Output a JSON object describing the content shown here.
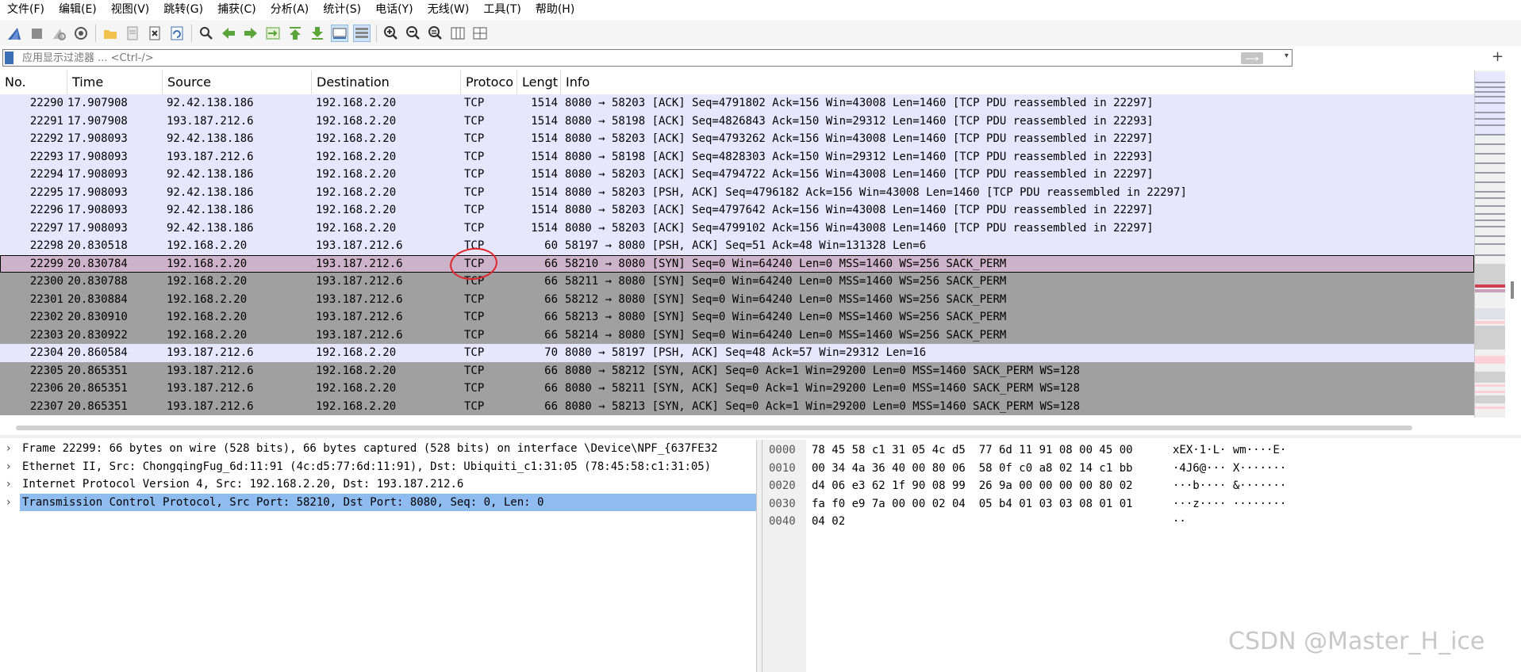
{
  "menubar": {
    "items": [
      "文件(F)",
      "编辑(E)",
      "视图(V)",
      "跳转(G)",
      "捕获(C)",
      "分析(A)",
      "统计(S)",
      "电话(Y)",
      "无线(W)",
      "工具(T)",
      "帮助(H)"
    ]
  },
  "toolbar": {
    "buttons": [
      "shark-fin-start-icon",
      "stop-icon",
      "restart-icon",
      "capture-options-icon",
      "open-folder-icon",
      "save-file-icon",
      "close-file-icon",
      "reload-icon",
      "find-icon",
      "go-back-icon",
      "go-forward-icon",
      "go-to-packet-icon",
      "go-first-icon",
      "go-last-icon",
      "autoscroll-icon",
      "colorize-icon",
      "zoom-in-icon",
      "zoom-out-icon",
      "zoom-normal-icon",
      "resize-columns-icon",
      "layout-icon"
    ]
  },
  "filter": {
    "placeholder": "应用显示过滤器 ... <Ctrl-/>",
    "apply_arrow": "⟶",
    "dropdown": "▾",
    "add": "+"
  },
  "packet_list": {
    "columns": [
      "No.",
      "Time",
      "Source",
      "Destination",
      "Protoco",
      "Lengt",
      "Info"
    ],
    "rows": [
      {
        "no": "22290",
        "time": "17.907908",
        "src": "92.42.138.186",
        "dst": "192.168.2.20",
        "proto": "TCP",
        "len": "1514",
        "info": "8080 → 58203 [ACK] Seq=4791802 Ack=156 Win=43008 Len=1460 [TCP PDU reassembled in 22297]",
        "style": "ack"
      },
      {
        "no": "22291",
        "time": "17.907908",
        "src": "193.187.212.6",
        "dst": "192.168.2.20",
        "proto": "TCP",
        "len": "1514",
        "info": "8080 → 58198 [ACK] Seq=4826843 Ack=150 Win=29312 Len=1460 [TCP PDU reassembled in 22293]",
        "style": "ack"
      },
      {
        "no": "22292",
        "time": "17.908093",
        "src": "92.42.138.186",
        "dst": "192.168.2.20",
        "proto": "TCP",
        "len": "1514",
        "info": "8080 → 58203 [ACK] Seq=4793262 Ack=156 Win=43008 Len=1460 [TCP PDU reassembled in 22297]",
        "style": "ack"
      },
      {
        "no": "22293",
        "time": "17.908093",
        "src": "193.187.212.6",
        "dst": "192.168.2.20",
        "proto": "TCP",
        "len": "1514",
        "info": "8080 → 58198 [ACK] Seq=4828303 Ack=150 Win=29312 Len=1460 [TCP PDU reassembled in 22293]",
        "style": "ack"
      },
      {
        "no": "22294",
        "time": "17.908093",
        "src": "92.42.138.186",
        "dst": "192.168.2.20",
        "proto": "TCP",
        "len": "1514",
        "info": "8080 → 58203 [ACK] Seq=4794722 Ack=156 Win=43008 Len=1460 [TCP PDU reassembled in 22297]",
        "style": "ack"
      },
      {
        "no": "22295",
        "time": "17.908093",
        "src": "92.42.138.186",
        "dst": "192.168.2.20",
        "proto": "TCP",
        "len": "1514",
        "info": "8080 → 58203 [PSH, ACK] Seq=4796182 Ack=156 Win=43008 Len=1460 [TCP PDU reassembled in 22297]",
        "style": "ack"
      },
      {
        "no": "22296",
        "time": "17.908093",
        "src": "92.42.138.186",
        "dst": "192.168.2.20",
        "proto": "TCP",
        "len": "1514",
        "info": "8080 → 58203 [ACK] Seq=4797642 Ack=156 Win=43008 Len=1460 [TCP PDU reassembled in 22297]",
        "style": "ack"
      },
      {
        "no": "22297",
        "time": "17.908093",
        "src": "92.42.138.186",
        "dst": "192.168.2.20",
        "proto": "TCP",
        "len": "1514",
        "info": "8080 → 58203 [ACK] Seq=4799102 Ack=156 Win=43008 Len=1460 [TCP PDU reassembled in 22297]",
        "style": "ack"
      },
      {
        "no": "22298",
        "time": "20.830518",
        "src": "192.168.2.20",
        "dst": "193.187.212.6",
        "proto": "TCP",
        "len": "60",
        "info": "58197 → 8080 [PSH, ACK] Seq=51 Ack=48 Win=131328 Len=6",
        "style": "ack"
      },
      {
        "no": "22299",
        "time": "20.830784",
        "src": "192.168.2.20",
        "dst": "193.187.212.6",
        "proto": "TCP",
        "len": "66",
        "info": "58210 → 8080 [SYN] Seq=0 Win=64240 Len=0 MSS=1460 WS=256 SACK_PERM",
        "style": "sel"
      },
      {
        "no": "22300",
        "time": "20.830788",
        "src": "192.168.2.20",
        "dst": "193.187.212.6",
        "proto": "TCP",
        "len": "66",
        "info": "58211 → 8080 [SYN] Seq=0 Win=64240 Len=0 MSS=1460 WS=256 SACK_PERM",
        "style": "syn"
      },
      {
        "no": "22301",
        "time": "20.830884",
        "src": "192.168.2.20",
        "dst": "193.187.212.6",
        "proto": "TCP",
        "len": "66",
        "info": "58212 → 8080 [SYN] Seq=0 Win=64240 Len=0 MSS=1460 WS=256 SACK_PERM",
        "style": "syn"
      },
      {
        "no": "22302",
        "time": "20.830910",
        "src": "192.168.2.20",
        "dst": "193.187.212.6",
        "proto": "TCP",
        "len": "66",
        "info": "58213 → 8080 [SYN] Seq=0 Win=64240 Len=0 MSS=1460 WS=256 SACK_PERM",
        "style": "syn"
      },
      {
        "no": "22303",
        "time": "20.830922",
        "src": "192.168.2.20",
        "dst": "193.187.212.6",
        "proto": "TCP",
        "len": "66",
        "info": "58214 → 8080 [SYN] Seq=0 Win=64240 Len=0 MSS=1460 WS=256 SACK_PERM",
        "style": "syn"
      },
      {
        "no": "22304",
        "time": "20.860584",
        "src": "193.187.212.6",
        "dst": "192.168.2.20",
        "proto": "TCP",
        "len": "70",
        "info": "8080 → 58197 [PSH, ACK] Seq=48 Ack=57 Win=29312 Len=16",
        "style": "ack"
      },
      {
        "no": "22305",
        "time": "20.865351",
        "src": "193.187.212.6",
        "dst": "192.168.2.20",
        "proto": "TCP",
        "len": "66",
        "info": "8080 → 58212 [SYN, ACK] Seq=0 Ack=1 Win=29200 Len=0 MSS=1460 SACK_PERM WS=128",
        "style": "syn"
      },
      {
        "no": "22306",
        "time": "20.865351",
        "src": "193.187.212.6",
        "dst": "192.168.2.20",
        "proto": "TCP",
        "len": "66",
        "info": "8080 → 58211 [SYN, ACK] Seq=0 Ack=1 Win=29200 Len=0 MSS=1460 SACK_PERM WS=128",
        "style": "syn"
      },
      {
        "no": "22307",
        "time": "20.865351",
        "src": "193.187.212.6",
        "dst": "192.168.2.20",
        "proto": "TCP",
        "len": "66",
        "info": "8080 → 58213 [SYN, ACK] Seq=0 Ack=1 Win=29200 Len=0 MSS=1460 SACK_PERM WS=128",
        "style": "syn"
      }
    ]
  },
  "details": {
    "arrow": "›",
    "items": [
      {
        "text": "Frame 22299: 66 bytes on wire (528 bits), 66 bytes captured (528 bits) on interface \\Device\\NPF_{637FE32",
        "selected": false
      },
      {
        "text": "Ethernet II, Src: ChongqingFug_6d:11:91 (4c:d5:77:6d:11:91), Dst: Ubiquiti_c1:31:05 (78:45:58:c1:31:05)",
        "selected": false
      },
      {
        "text": "Internet Protocol Version 4, Src: 192.168.2.20, Dst: 193.187.212.6",
        "selected": false
      },
      {
        "text": "Transmission Control Protocol, Src Port: 58210, Dst Port: 8080, Seq: 0, Len: 0",
        "selected": true
      }
    ]
  },
  "bytes": {
    "rows": [
      {
        "offset": "0000",
        "hex": "78 45 58 c1 31 05 4c d5  77 6d 11 91 08 00 45 00",
        "ascii": "xEX·1·L· wm····E·"
      },
      {
        "offset": "0010",
        "hex": "00 34 4a 36 40 00 80 06  58 0f c0 a8 02 14 c1 bb",
        "ascii": "·4J6@··· X·······"
      },
      {
        "offset": "0020",
        "hex": "d4 06 e3 62 1f 90 08 99  26 9a 00 00 00 00 80 02",
        "ascii": "···b···· &·······"
      },
      {
        "offset": "0030",
        "hex": "fa f0 e9 7a 00 00 02 04  05 b4 01 03 03 08 01 01",
        "ascii": "···z···· ········"
      },
      {
        "offset": "0040",
        "hex": "04 02",
        "ascii": "··"
      }
    ]
  },
  "watermark": "CSDN @Master_H_ice",
  "colors": {
    "ack_row": "#e7e6ff",
    "syn_row": "#a0a0a0",
    "selected_row": "#cdb3c9",
    "detail_selected": "#8fbcf0",
    "annotation_circle": "#e0262b"
  }
}
